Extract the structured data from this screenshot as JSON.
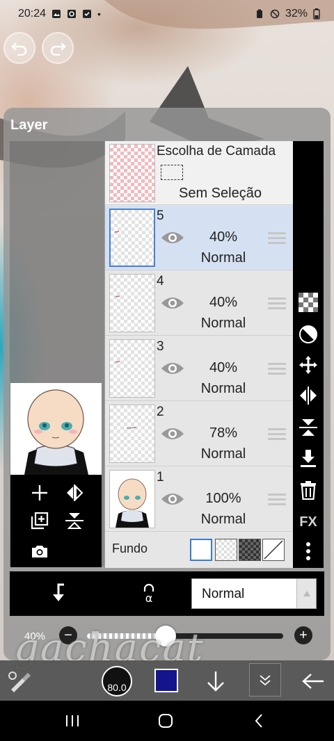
{
  "status_bar": {
    "time": "20:24",
    "battery": "32%"
  },
  "panel": {
    "title": "Layer"
  },
  "selection_row": {
    "title": "Escolha de Camada",
    "subtitle": "Sem Seleção"
  },
  "layers": [
    {
      "number": "5",
      "opacity": "40%",
      "blend": "Normal",
      "selected": true
    },
    {
      "number": "4",
      "opacity": "40%",
      "blend": "Normal",
      "selected": false
    },
    {
      "number": "3",
      "opacity": "40%",
      "blend": "Normal",
      "selected": false
    },
    {
      "number": "2",
      "opacity": "78%",
      "blend": "Normal",
      "selected": false
    },
    {
      "number": "1",
      "opacity": "100%",
      "blend": "Normal",
      "selected": false
    }
  ],
  "background": {
    "label": "Fundo"
  },
  "right_tools": {
    "fx_label": "FX"
  },
  "blend_select": {
    "value": "Normal"
  },
  "opacity_slider": {
    "label": "40%",
    "value": 0.4
  },
  "watermark": "gachacat",
  "toolbar": {
    "brush_size": "80.0",
    "color": "#14148c"
  },
  "colors": {
    "selected_row": "#d5e1f2",
    "panel_bg": "#969696",
    "accent": "#4a7fd6"
  }
}
